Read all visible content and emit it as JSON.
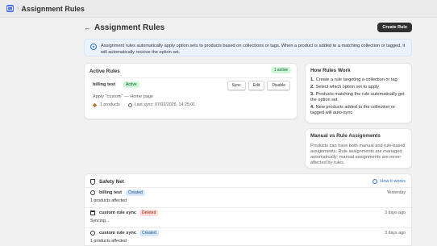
{
  "topbar": {
    "title": "Assignment Rules"
  },
  "page": {
    "title": "Assignment Rules",
    "create_button": "Create Rule"
  },
  "banner": {
    "text": "Assignment rules automatically apply option sets to products based on collections or tags. When a product is added to a matching collection or tagged, it will automatically receive the option set."
  },
  "active_rules": {
    "heading": "Active Rules",
    "count_badge": "1 active",
    "rules": [
      {
        "name": "billing test",
        "status": "Active",
        "description": "Apply \"custom\" — Home page",
        "products": "1 products",
        "last_sync": "Last sync: 07/02/2026, 14:25:01",
        "actions": {
          "sync": "Sync",
          "edit": "Edit",
          "disable": "Disable"
        }
      }
    ]
  },
  "how_rules_work": {
    "heading": "How Rules Work",
    "steps": [
      {
        "num": "1.",
        "text": "Create a rule targeting a collection or tag"
      },
      {
        "num": "2.",
        "text": "Select which option set to apply"
      },
      {
        "num": "3.",
        "text": "Products matching the rule automatically get the option set"
      },
      {
        "num": "4.",
        "text": "New products added to the collection or tagged will auto-sync"
      }
    ]
  },
  "manual_vs_rule": {
    "heading": "Manual vs Rule Assignments",
    "text": "Products can have both manual and rule-based assignments. Rule assignments are managed automatically; manual assignments are never affected by rules."
  },
  "safety_net": {
    "heading": "Safety Net",
    "link": "How it works",
    "log": [
      {
        "icon": "sync-icon",
        "name": "billing test",
        "badge": "Created",
        "badge_type": "created",
        "time": "Yesterday",
        "detail": "1 products affected"
      },
      {
        "icon": "trash-icon",
        "name": "custom rule sync",
        "badge": "Deleted",
        "badge_type": "deleted",
        "time": "3 days ago",
        "detail": "Syncing..."
      },
      {
        "icon": "sync-icon",
        "name": "custom rule sync",
        "badge": "Created",
        "badge_type": "created",
        "time": "3 days ago",
        "detail": "1 products affected"
      }
    ]
  }
}
